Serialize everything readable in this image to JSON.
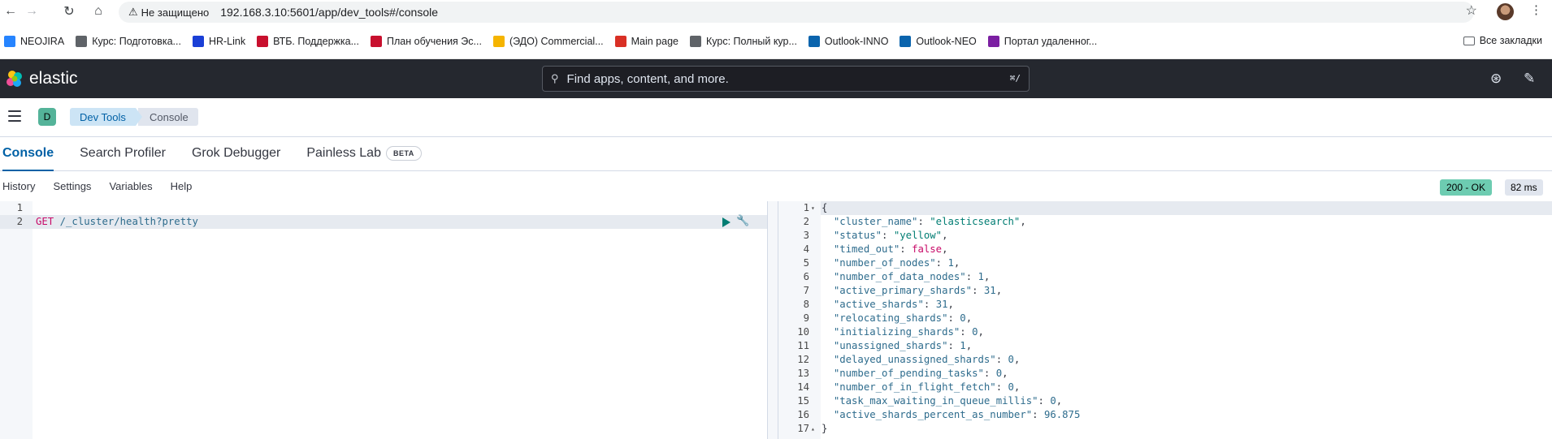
{
  "browser": {
    "security_label": "Не защищено",
    "url": "192.168.3.10:5601/app/dev_tools#/console",
    "bookmarks": [
      {
        "label": "NEOJIRA",
        "icon": "jira-icon",
        "color": "#2684ff"
      },
      {
        "label": "Курс: Подготовка...",
        "icon": "globe-icon",
        "color": "#5f6368"
      },
      {
        "label": "HR-Link",
        "icon": "hrlink-icon",
        "color": "#1a3fd6"
      },
      {
        "label": "ВТБ. Поддержка...",
        "icon": "vtb-icon",
        "color": "#c8102e"
      },
      {
        "label": "План обучения Эс...",
        "icon": "vtb-icon",
        "color": "#c8102e"
      },
      {
        "label": "(ЭДО) Commercial...",
        "icon": "1c-icon",
        "color": "#f5b400"
      },
      {
        "label": "Main page",
        "icon": "tools-icon",
        "color": "#d93025"
      },
      {
        "label": "Курс: Полный кур...",
        "icon": "globe-icon",
        "color": "#5f6368"
      },
      {
        "label": "Outlook-INNO",
        "icon": "outlook-icon",
        "color": "#0a64ad"
      },
      {
        "label": "Outlook-NEO",
        "icon": "outlook-icon",
        "color": "#0a64ad"
      },
      {
        "label": "Портал удаленног...",
        "icon": "portal-icon",
        "color": "#7b1fa2"
      }
    ],
    "all_bookmarks": "Все закладки"
  },
  "header": {
    "brand": "elastic",
    "search_placeholder": "Find apps, content, and more.",
    "search_shortcut": "⌘/"
  },
  "breadcrumbs": {
    "space_initial": "D",
    "items": [
      "Dev Tools",
      "Console"
    ]
  },
  "tabs": [
    {
      "label": "Console",
      "active": true
    },
    {
      "label": "Search Profiler",
      "active": false
    },
    {
      "label": "Grok Debugger",
      "active": false
    },
    {
      "label": "Painless Lab",
      "active": false,
      "badge": "BETA"
    }
  ],
  "toolbar": {
    "history": "History",
    "settings": "Settings",
    "variables": "Variables",
    "help": "Help",
    "status": "200 - OK",
    "elapsed": "82 ms"
  },
  "request": {
    "line_numbers": [
      "1",
      "2"
    ],
    "method": "GET",
    "path": "/_cluster/health?pretty"
  },
  "response": {
    "line_numbers": [
      "1",
      "2",
      "3",
      "4",
      "5",
      "6",
      "7",
      "8",
      "9",
      "10",
      "11",
      "12",
      "13",
      "14",
      "15",
      "16",
      "17"
    ],
    "open_brace": "{",
    "close_brace": "}",
    "fields": [
      {
        "key": "\"cluster_name\"",
        "value": "\"elasticsearch\"",
        "type": "s"
      },
      {
        "key": "\"status\"",
        "value": "\"yellow\"",
        "type": "s"
      },
      {
        "key": "\"timed_out\"",
        "value": "false",
        "type": "b"
      },
      {
        "key": "\"number_of_nodes\"",
        "value": "1",
        "type": "n"
      },
      {
        "key": "\"number_of_data_nodes\"",
        "value": "1",
        "type": "n"
      },
      {
        "key": "\"active_primary_shards\"",
        "value": "31",
        "type": "n"
      },
      {
        "key": "\"active_shards\"",
        "value": "31",
        "type": "n"
      },
      {
        "key": "\"relocating_shards\"",
        "value": "0",
        "type": "n"
      },
      {
        "key": "\"initializing_shards\"",
        "value": "0",
        "type": "n"
      },
      {
        "key": "\"unassigned_shards\"",
        "value": "1",
        "type": "n"
      },
      {
        "key": "\"delayed_unassigned_shards\"",
        "value": "0",
        "type": "n"
      },
      {
        "key": "\"number_of_pending_tasks\"",
        "value": "0",
        "type": "n"
      },
      {
        "key": "\"number_of_in_flight_fetch\"",
        "value": "0",
        "type": "n"
      },
      {
        "key": "\"task_max_waiting_in_queue_millis\"",
        "value": "0",
        "type": "n"
      },
      {
        "key": "\"active_shards_percent_as_number\"",
        "value": "96.875",
        "type": "n"
      }
    ]
  }
}
